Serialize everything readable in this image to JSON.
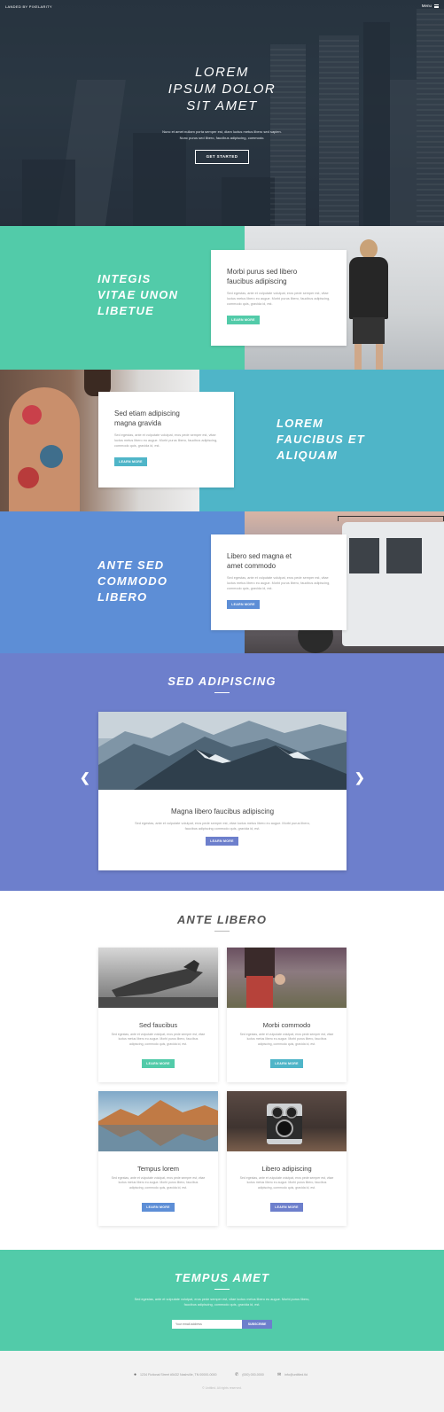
{
  "colors": {
    "teal": "#52cba9",
    "cyan": "#4fb5c8",
    "blue": "#5d8ed6",
    "indigo": "#6d7fcc",
    "hero_bg": "#2d3a46",
    "footer_bg": "#f2f2f2"
  },
  "header": {
    "brand": "Landed by Pixelarity",
    "menu_label": "Menu",
    "menu_icon": "hamburger-icon"
  },
  "hero": {
    "title_lines": [
      "Lorem",
      "Ipsum Dolor",
      "Sit Amet"
    ],
    "text_line1": "Nunc et amet nullam porta semper est, diam luctus metus libero sed sapien.",
    "text_line2": "Nunc purus sed libero, faucibus adipiscing, commodo.",
    "button": "Get Started"
  },
  "spotlights": [
    {
      "heading_lines": [
        "Integis",
        "Vitae Unon",
        "Libetue"
      ],
      "card_title_lines": [
        "Morbi purus sed libero",
        "faucibus adipiscing"
      ],
      "card_text": "Sed egestas, ante et vulputate volutpat, eros pede semper est, vitae luctus metus libero eu augue. Morbi purus libero, faucibus adipiscing, commodo quis, gravida id, est.",
      "button": "Learn More"
    },
    {
      "heading_lines": [
        "Lorem",
        "Faucibus et",
        "Aliquam"
      ],
      "card_title_lines": [
        "Sed etiam adipiscing",
        "magna gravida"
      ],
      "card_text": "Sed egestas, ante et vulputate volutpat, eros pede semper est, vitae luctus metus libero eu augue. Morbi purus libero, faucibus adipiscing, commodo quis, gravida id, est.",
      "button": "Learn More"
    },
    {
      "heading_lines": [
        "Ante Sed",
        "Commodo",
        "Libero"
      ],
      "card_title_lines": [
        "Libero sed magna et",
        "amet commodo"
      ],
      "card_text": "Sed egestas, ante et vulputate volutpat, eros pede semper est, vitae luctus metus libero eu augue. Morbi purus libero, faucibus adipiscing, commodo quis, gravida id, est.",
      "button": "Learn More"
    }
  ],
  "carousel": {
    "title": "Sed Adipiscing",
    "slide_title": "Magna libero faucibus adipiscing",
    "slide_text": "Sed egestas, ante et vulputate volutpat, eros pede semper est, vitae luctus metus libero eu augue. Morbi purus libero, faucibus adipiscing commodo quis, gravida id, est.",
    "button": "Learn More",
    "prev_icon": "chevron-left-icon",
    "next_icon": "chevron-right-icon"
  },
  "grid": {
    "title": "Ante Libero",
    "items": [
      {
        "title": "Sed faucibus",
        "text": "Sed egestas, ante et vulputate volutpat, eros pede semper est, vitae luctus metus libero eu augue. Morbi purus libero, faucibus adipiscing, commodo quis, gravida id, est.",
        "button": "Learn More"
      },
      {
        "title": "Morbi commodo",
        "text": "Sed egestas, ante et vulputate volutpat, eros pede semper est, vitae luctus metus libero eu augue. Morbi purus libero, faucibus adipiscing, commodo quis, gravida id, est.",
        "button": "Learn More"
      },
      {
        "title": "Tempus lorem",
        "text": "Sed egestas, ante et vulputate volutpat, eros pede semper est, vitae luctus metus libero eu augue. Morbi purus libero, faucibus adipiscing, commodo quis, gravida id, est.",
        "button": "Learn More"
      },
      {
        "title": "Libero adipiscing",
        "text": "Sed egestas, ante et vulputate volutpat, eros pede semper est, vitae luctus metus libero eu augue. Morbi purus libero, faucibus adipiscing, commodo quis, gravida id, est.",
        "button": "Learn More"
      }
    ]
  },
  "newsletter": {
    "title": "Tempus Amet",
    "text": "Sed egestas, ante et vulputate volutpat, eros pede semper est, vitae luctus metus libero eu augue. Morbi purus libero, faucibus adipiscing, commodo quis, gravida id, est.",
    "placeholder": "Your email address",
    "button": "Subscribe"
  },
  "footer": {
    "address": "1234 Fictional Street #5432 Nashville, TN 00000-0000",
    "phone": "(000) 000-0000",
    "email": "info@untitled.tld",
    "copyright": "© Untitled. All rights reserved."
  }
}
